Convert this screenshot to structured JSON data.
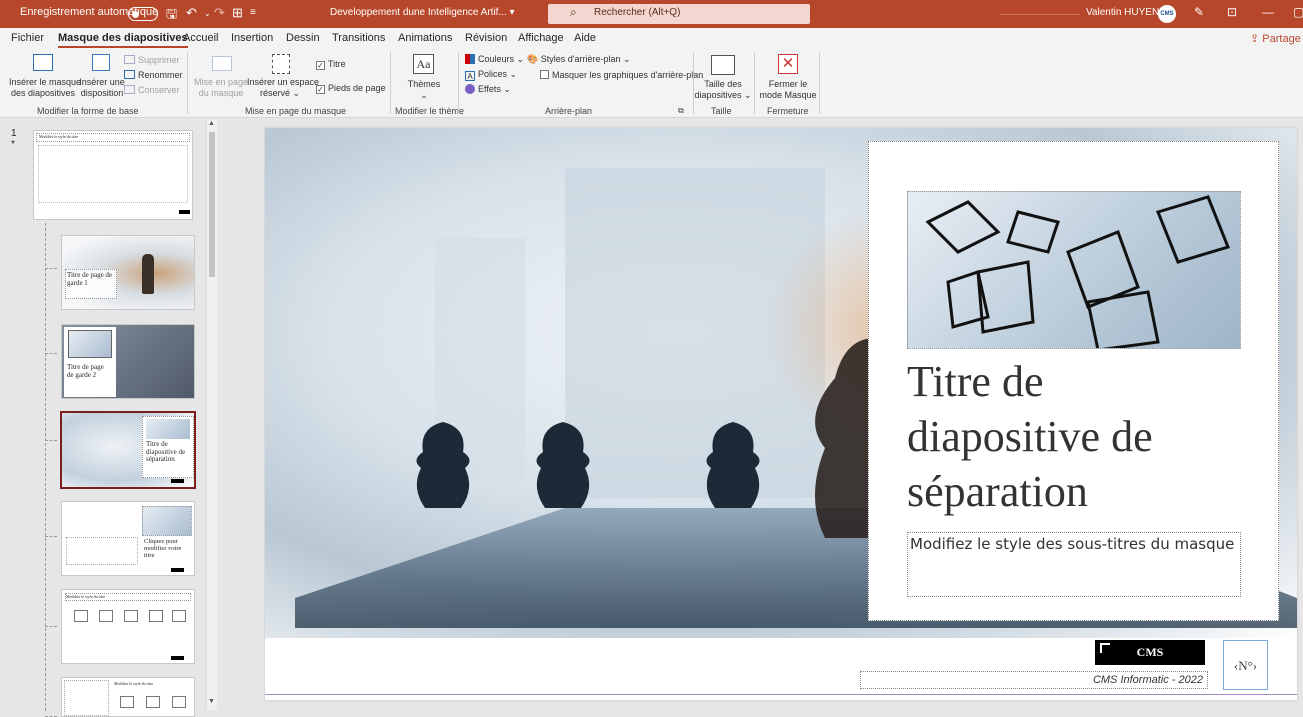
{
  "titlebar": {
    "autosave": "Enregistrement automatique",
    "doc_title": "Developpement dune Intelligence Artif... ▾",
    "search": "Rechercher (Alt+Q)",
    "user": "Valentin HUYENH",
    "avatar": "CMS"
  },
  "tabs": [
    "Fichier",
    "Masque des diapositives",
    "Accueil",
    "Insertion",
    "Dessin",
    "Transitions",
    "Animations",
    "Révision",
    "Affichage",
    "Aide"
  ],
  "share": "Partage",
  "ribbon": {
    "insert_master": [
      "Insérer le masque",
      "des diapositives"
    ],
    "insert_layout": [
      "Insérer une",
      "disposition"
    ],
    "delete": "Supprimer",
    "rename": "Renommer",
    "preserve": "Conserver",
    "group1": "Modifier la forme de base",
    "layout_master": [
      "Mise en page",
      "du masque"
    ],
    "insert_placeholder": [
      "Insérer un espace",
      "réservé ⌄"
    ],
    "title_chk": "Titre",
    "footers_chk": "Pieds de page",
    "group2": "Mise en page du masque",
    "themes": "Thèmes",
    "group3": "Modifier le thème",
    "colors": "Couleurs ⌄",
    "fonts": "Polices ⌄",
    "effects": "Effets ⌄",
    "bg_styles": "Styles d'arrière-plan ⌄",
    "hide_bg": "Masquer les graphiques d'arrière-plan",
    "group4": "Arrière-plan",
    "slide_size": [
      "Taille des",
      "diapositives ⌄"
    ],
    "group5": "Taille",
    "close_master": [
      "Fermer le",
      "mode Masque"
    ],
    "group6": "Fermeture"
  },
  "thumbnails": {
    "master_num": "1",
    "master_star": "*",
    "master_title": "Modifier le style du titre",
    "t1": [
      "Titre de page de",
      "garde 1"
    ],
    "t2": [
      "Titre de page",
      "de garde 2"
    ],
    "t3": [
      "Titre de",
      "diapositive de",
      "séparation"
    ],
    "t4": [
      "Cliquez pour",
      "modifier votre",
      "titre"
    ],
    "t5": "Modifier le style du titre",
    "t6": "Modifier le style du titre"
  },
  "slide": {
    "title": "Titre de diapositive de séparation",
    "subtitle": "Modifiez le style des sous-titres du masque",
    "logo": "CMS",
    "number": "‹N°›",
    "footer": "CMS Informatic - 2022"
  },
  "colors": {
    "accent": "#b7472a",
    "selected_thumb": "#7a1f1f"
  }
}
